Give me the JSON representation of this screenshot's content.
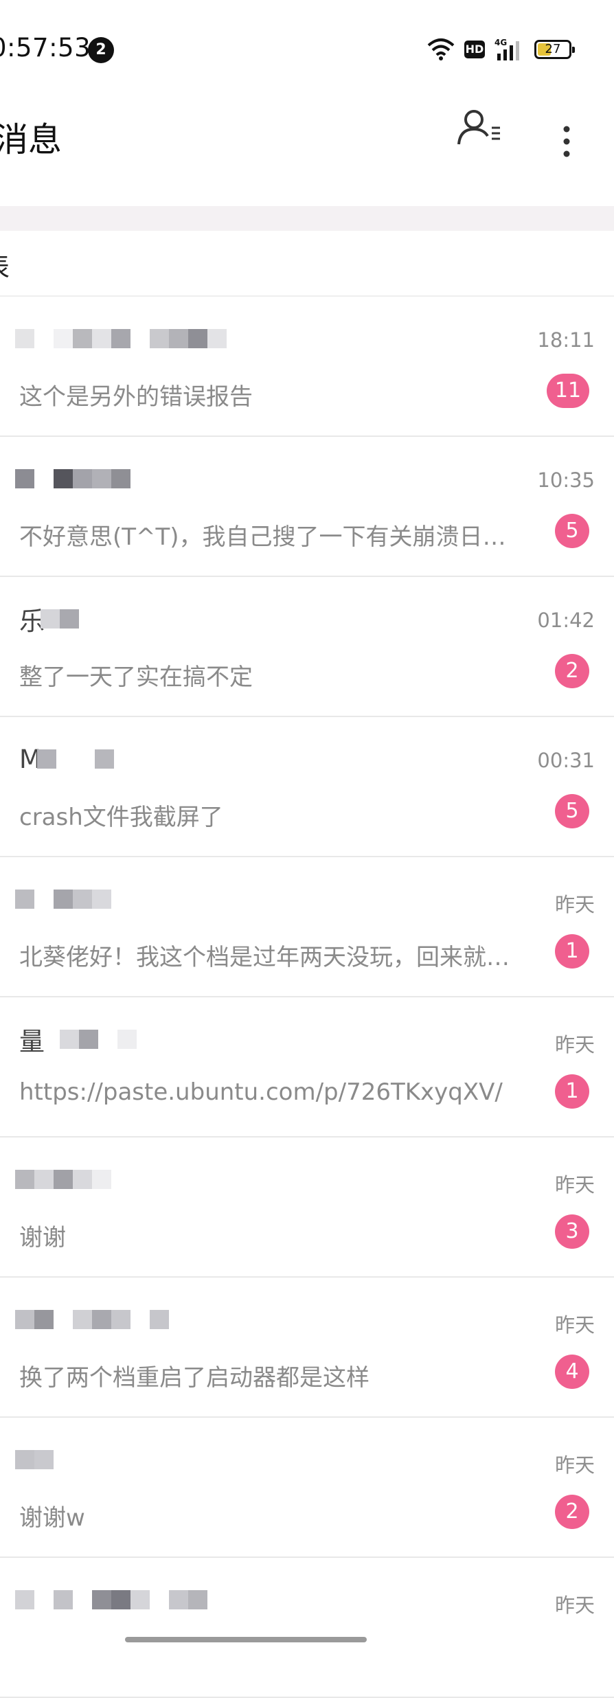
{
  "status_bar": {
    "time": "0:57:53",
    "notification_count": "2",
    "hd_label": "HD",
    "network_label": "4G",
    "battery_level": "27"
  },
  "header": {
    "title": "消息",
    "contacts_icon": "contacts-list-icon",
    "more_icon": "more-vertical-icon"
  },
  "section": {
    "label": "表"
  },
  "conversations": [
    {
      "name": "",
      "time": "18:11",
      "preview": "这个是另外的错误报告",
      "unread": "11"
    },
    {
      "name": "",
      "time": "10:35",
      "preview": "不好意思(T^T)，我自己搜了一下有关崩溃日志的问题",
      "unread": "5"
    },
    {
      "name": "乐",
      "time": "01:42",
      "preview": "整了一天了实在搞不定",
      "unread": "2"
    },
    {
      "name": "M",
      "time": "00:31",
      "preview": "crash文件我截屏了",
      "unread": "5"
    },
    {
      "name": "",
      "time": "昨天",
      "preview": "北葵佬好！我这个档是过年两天没玩，回来就打不开了",
      "unread": "1"
    },
    {
      "name": "量",
      "time": "昨天",
      "preview": "https://paste.ubuntu.com/p/726TKxyqXV/",
      "unread": "1"
    },
    {
      "name": "",
      "time": "昨天",
      "preview": "谢谢",
      "unread": "3"
    },
    {
      "name": "",
      "time": "昨天",
      "preview": "换了两个档重启了启动器都是这样",
      "unread": "4"
    },
    {
      "name": "",
      "time": "昨天",
      "preview": "谢谢w",
      "unread": "2"
    },
    {
      "name": "",
      "time": "昨天",
      "preview": "",
      "unread": ""
    }
  ],
  "colors": {
    "badge": "#f05f8f",
    "divider_band": "#f4f1f3",
    "secondary_text": "#8a8a8a"
  }
}
